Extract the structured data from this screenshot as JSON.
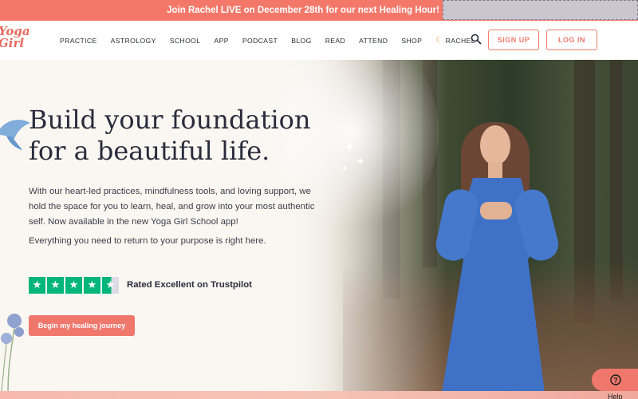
{
  "announcement": {
    "text": "Join Rachel LIVE on December 28th for our next Healing Hour!"
  },
  "logo": {
    "line1": "Yoga",
    "line2": "Girl"
  },
  "nav": {
    "items": [
      "PRACTICE",
      "ASTROLOGY",
      "SCHOOL",
      "APP",
      "PODCAST",
      "BLOG",
      "READ",
      "ATTEND",
      "SHOP"
    ],
    "rachel_label": "RACHEL",
    "signup_label": "SIGN UP",
    "login_label": "LOG IN"
  },
  "hero": {
    "headline_line1": "Build your foundation",
    "headline_line2": "for a beautiful life.",
    "lead": "With our heart-led practices, mindfulness tools, and loving support, we hold the space for you to learn, heal, and grow into your most authentic self. Now available in the new Yoga Girl School app!",
    "sub": "Everything you need to return to your purpose is right here.",
    "trustpilot_text": "Rated Excellent on Trustpilot",
    "trustpilot_rating": 4.5,
    "cta_label": "Begin my healing journey"
  },
  "help": {
    "label": "Help"
  },
  "colors": {
    "accent": "#f0776c",
    "trustpilot_green": "#00b67a",
    "text_dark": "#2a2c3c"
  }
}
